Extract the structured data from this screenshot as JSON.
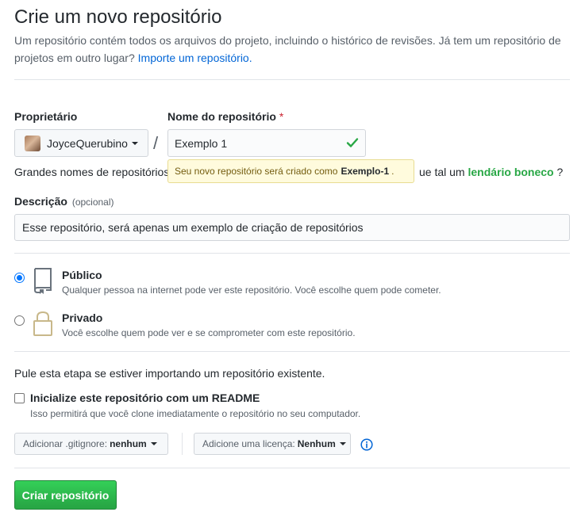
{
  "header": {
    "title": "Crie um novo repositório",
    "intro": "Um repositório contém todos os arquivos do projeto, incluindo o histórico de revisões. Já tem um repositório de projetos em outro lugar?",
    "import_link": "Importe um repositório."
  },
  "owner": {
    "label": "Proprietário",
    "name": "JoyceQuerubino"
  },
  "repo": {
    "label": "Nome do repositório",
    "required_mark": "*",
    "value": "Exemplo 1",
    "separator": "/"
  },
  "hint": {
    "prefix": "Grandes nomes de repositórios",
    "suffix": "ue tal um",
    "suggestion": "lendário boneco",
    "end": "?"
  },
  "tooltip": {
    "text": "Seu novo repositório será criado como",
    "slug": "Exemplo-1",
    "end": "."
  },
  "description": {
    "label": "Descrição",
    "optional": "(opcional)",
    "value": "Esse repositório, será apenas um exemplo de criação de repositórios"
  },
  "visibility": [
    {
      "title": "Público",
      "note": "Qualquer pessoa na internet pode ver este repositório. Você escolhe quem pode cometer.",
      "checked": true,
      "icon": "repo-book-icon"
    },
    {
      "title": "Privado",
      "note": "Você escolhe quem pode ver e se comprometer com este repositório.",
      "checked": false,
      "icon": "lock-icon"
    }
  ],
  "init": {
    "skip_text": "Pule esta etapa se estiver importando um repositório existente.",
    "readme_label": "Inicialize este repositório com um README",
    "readme_note": "Isso permitirá que você clone imediatamente o repositório no seu computador.",
    "readme_checked": false
  },
  "gitignore": {
    "label": "Adicionar .gitignore:",
    "value": "nenhum"
  },
  "license": {
    "label": "Adicione uma licença:",
    "value": "Nenhum"
  },
  "submit": {
    "label": "Criar repositório"
  },
  "colors": {
    "accent": "#0366d6",
    "success": "#28a745",
    "required": "#cb2431",
    "tooltip_bg": "#fffbdd"
  }
}
